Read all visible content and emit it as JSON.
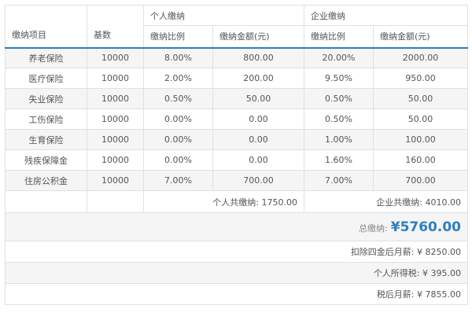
{
  "headers": {
    "item": "缴纳项目",
    "base": "基数",
    "personal_group": "个人缴纳",
    "company_group": "企业缴纳",
    "personal_rate": "缴纳比例",
    "personal_amount": "缴纳金额(元)",
    "company_rate": "缴纳比例",
    "company_amount": "缴纳金额(元)"
  },
  "rows": [
    {
      "name": "养老保险",
      "base": "10000",
      "p_rate": "8.00%",
      "p_amt": "800.00",
      "c_rate": "20.00%",
      "c_amt": "2000.00"
    },
    {
      "name": "医疗保险",
      "base": "10000",
      "p_rate": "2.00%",
      "p_amt": "200.00",
      "c_rate": "9.50%",
      "c_amt": "950.00"
    },
    {
      "name": "失业保险",
      "base": "10000",
      "p_rate": "0.50%",
      "p_amt": "50.00",
      "c_rate": "0.50%",
      "c_amt": "50.00"
    },
    {
      "name": "工伤保险",
      "base": "10000",
      "p_rate": "0.00%",
      "p_amt": "0.00",
      "c_rate": "0.50%",
      "c_amt": "50.00"
    },
    {
      "name": "生育保险",
      "base": "10000",
      "p_rate": "0.00%",
      "p_amt": "0.00",
      "c_rate": "1.00%",
      "c_amt": "100.00"
    },
    {
      "name": "残疾保障金",
      "base": "10000",
      "p_rate": "0.00%",
      "p_amt": "0.00",
      "c_rate": "1.60%",
      "c_amt": "160.00"
    },
    {
      "name": "住房公积金",
      "base": "10000",
      "p_rate": "7.00%",
      "p_amt": "700.00",
      "c_rate": "7.00%",
      "c_amt": "700.00"
    }
  ],
  "summary": {
    "personal_total": "个人共缴纳: 1750.00",
    "company_total": "企业共缴纳: 4010.00"
  },
  "total": {
    "label": "总缴纳:",
    "value": "¥5760.00"
  },
  "footer": {
    "after_deduction": "扣除四金后月薪: ¥ 8250.00",
    "income_tax": "个人所得税: ¥ 395.00",
    "after_tax": "税后月薪: ¥ 7855.00"
  },
  "colors": {
    "accent": "#2d7fc1",
    "zebra": "#f5f5f5",
    "border": "#e1e1e1"
  }
}
